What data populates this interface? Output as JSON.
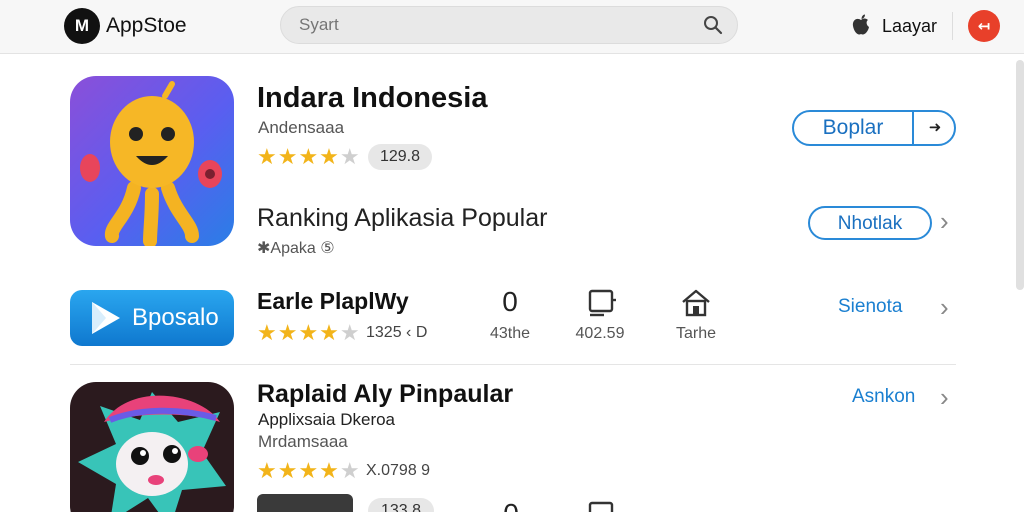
{
  "header": {
    "logo_text": "M",
    "brand": "AppStoe",
    "search_placeholder": "Syart",
    "account_label": "Laayar",
    "close_symbol": "↤",
    "accent": "#e8402a"
  },
  "featured": {
    "title": "Indara Indonesia",
    "developer": "Andensaaa",
    "rating_stars": 4,
    "rating_value": "129.8",
    "action_label": "Boplar",
    "action_arrow": "➜",
    "accent": "#1a7fd0"
  },
  "ranking": {
    "title": "Ranking Aplikasia Popular",
    "meta": "Apaka",
    "meta_prefix": "✱",
    "meta_badge": "⑤",
    "action_label": "Nhotlak"
  },
  "app2": {
    "badge_label": "Bposalo",
    "title": "Earle PlaplWy",
    "rating_stars": 4,
    "rating_text": "1325 ‹ D",
    "stats": [
      {
        "value": "0",
        "label": "43the"
      },
      {
        "value": "",
        "label": "402.59"
      },
      {
        "value": "",
        "label": "Tarhe"
      }
    ],
    "link_label": "Sienota"
  },
  "app3": {
    "title": "Raplaid Aly Pinpaular",
    "subtitle": "Applixsaia Dkeroa",
    "developer": "Mrdamsaaa",
    "rating_stars": 4,
    "rating_text": "X.0798  9",
    "link_label": "Asnkon",
    "bottom_pill": "133.8",
    "bottom_value": "0"
  },
  "icons": {
    "search": "search-icon",
    "apple": "apple-icon",
    "chevron": "chevron-right-icon",
    "device": "device-icon",
    "home": "home-icon",
    "play": "play-icon"
  }
}
